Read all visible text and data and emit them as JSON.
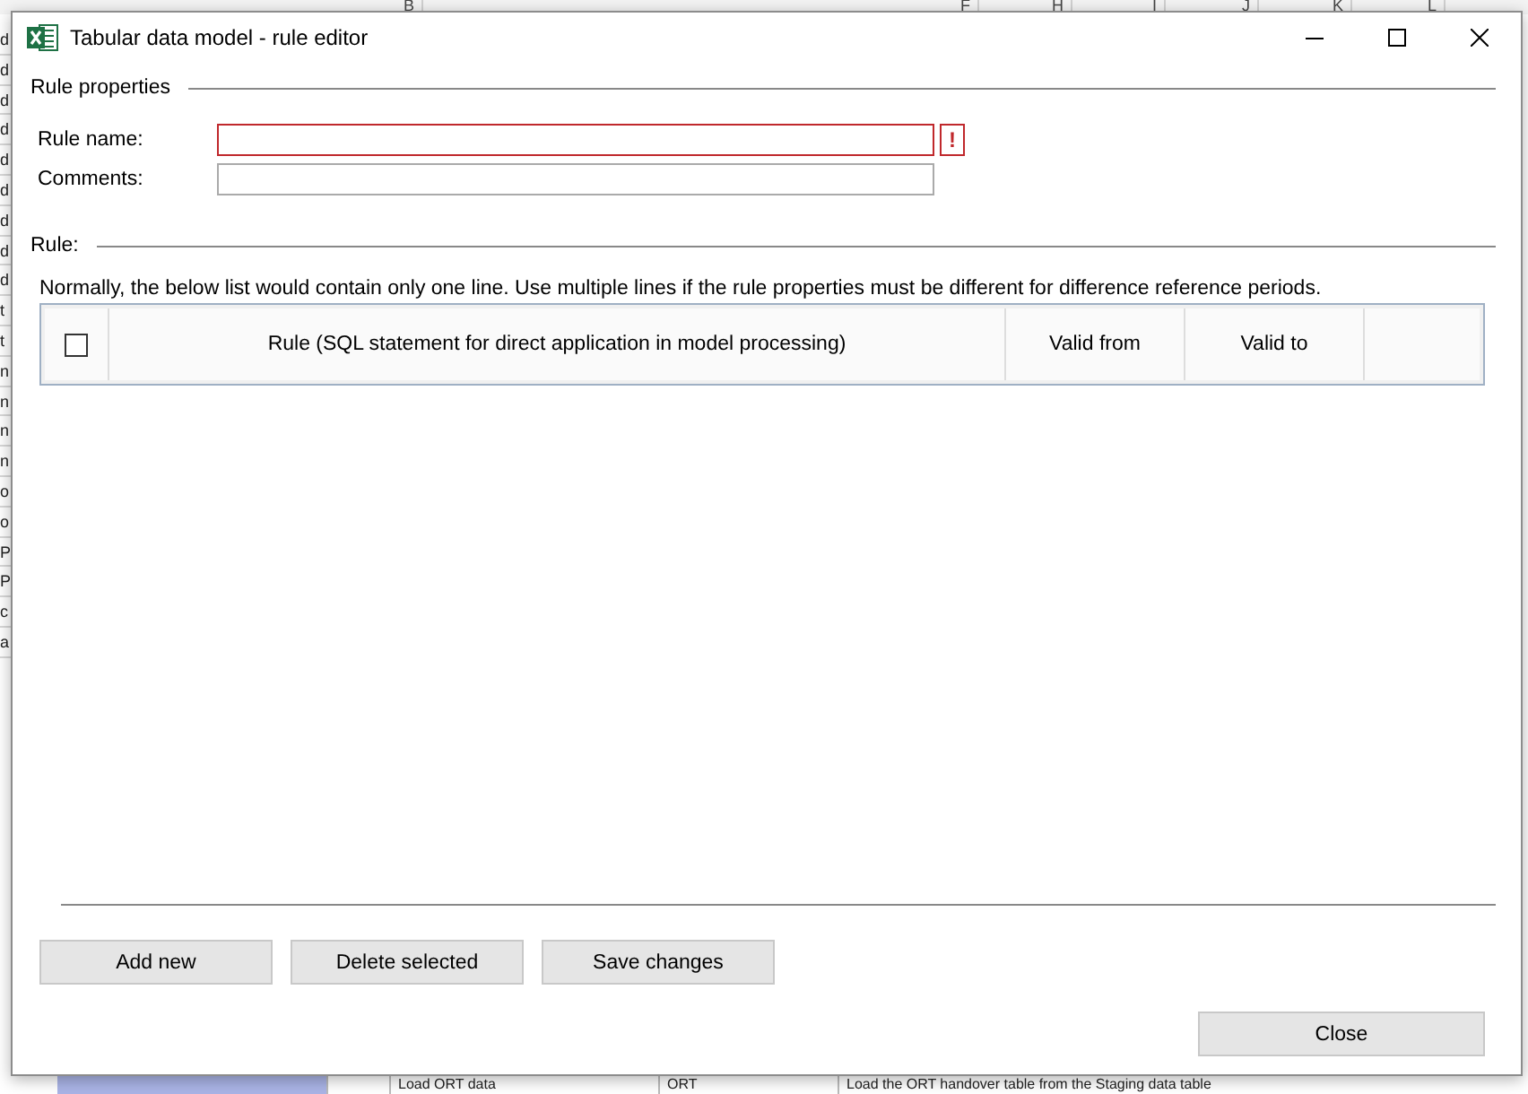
{
  "spreadsheet": {
    "column_headers": [
      "B",
      "F",
      "H",
      "I",
      "J",
      "K",
      "L"
    ],
    "left_column_fragments": [
      "d",
      "d",
      "d",
      "d",
      "d",
      "d",
      "d",
      "d",
      "d",
      "t",
      "t",
      "n",
      "n",
      "n",
      "n",
      "o",
      "o",
      "P",
      "P",
      "c",
      "a"
    ],
    "bottom_row": [
      "Load ORT data",
      "ORT",
      "Load the ORT handover table from the Staging data table"
    ]
  },
  "window": {
    "title": "Tabular data model - rule editor"
  },
  "rule_properties": {
    "heading": "Rule properties",
    "fields": [
      {
        "label": "Rule name:",
        "error": true,
        "error_mark": "!"
      },
      {
        "label": "Comments:",
        "error": false
      }
    ]
  },
  "rule": {
    "heading": "Rule:",
    "note": "Normally, the below list would contain only one line. Use multiple lines if the rule properties must be different for difference reference periods.",
    "table": {
      "select_all_checked": false,
      "columns": [
        "Rule (SQL statement for direct application in model processing)",
        "Valid from",
        "Valid to"
      ]
    }
  },
  "buttons": [
    "Add new",
    "Delete selected",
    "Save changes"
  ],
  "close_button": "Close"
}
